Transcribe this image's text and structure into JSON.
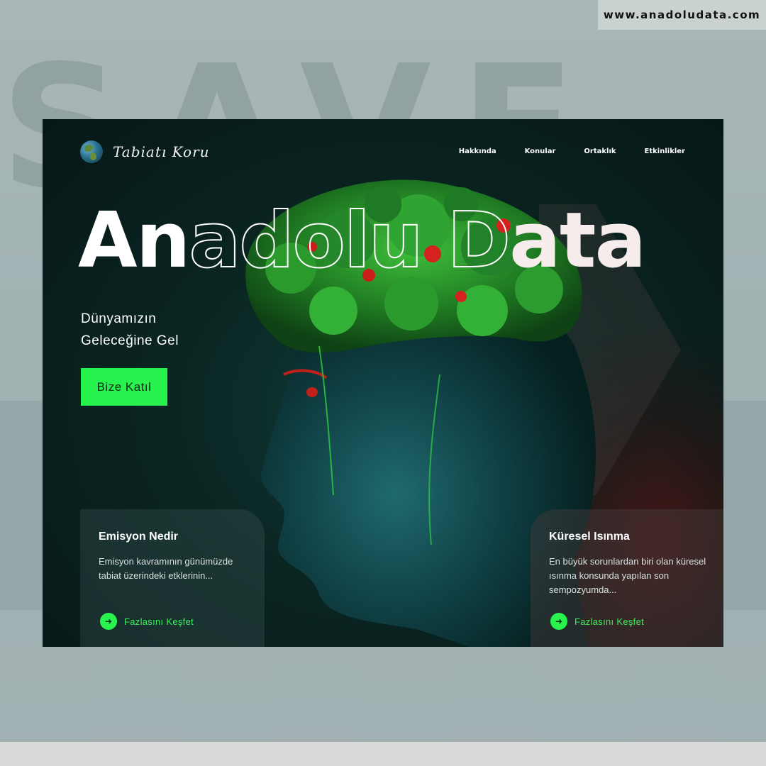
{
  "watermark": {
    "url": "www.anadoludata.com"
  },
  "background": {
    "letters": "SAVE"
  },
  "nav": {
    "logo_text": "Tabiatı Koru",
    "links": [
      "Hakkında",
      "Konular",
      "Ortaklık",
      "Etkinlikler"
    ]
  },
  "hero": {
    "title_part1": "An",
    "title_part2": "adolu",
    "title_part3": " D",
    "title_part4": "ata",
    "subtitle_line1": "Dünyamızın",
    "subtitle_line2": "Geleceğine Gel",
    "cta_label": "Bize Katıl"
  },
  "cards": [
    {
      "title": "Emisyon Nedir",
      "text": "Emisyon kavramının günümüzde tabiat üzerindeki etklerinin...",
      "link": "Fazlasını Keşfet"
    },
    {
      "title": "Küresel Isınma",
      "text": "En büyük sorunlardan biri olan küresel ısınma konsunda yapılan son sempozyumda...",
      "link": "Fazlasını Keşfet"
    }
  ],
  "colors": {
    "accent": "#28f24e",
    "card_bg": "#0a2522"
  },
  "icons": {
    "logo": "globe-icon",
    "more": "arrow-right-icon"
  }
}
